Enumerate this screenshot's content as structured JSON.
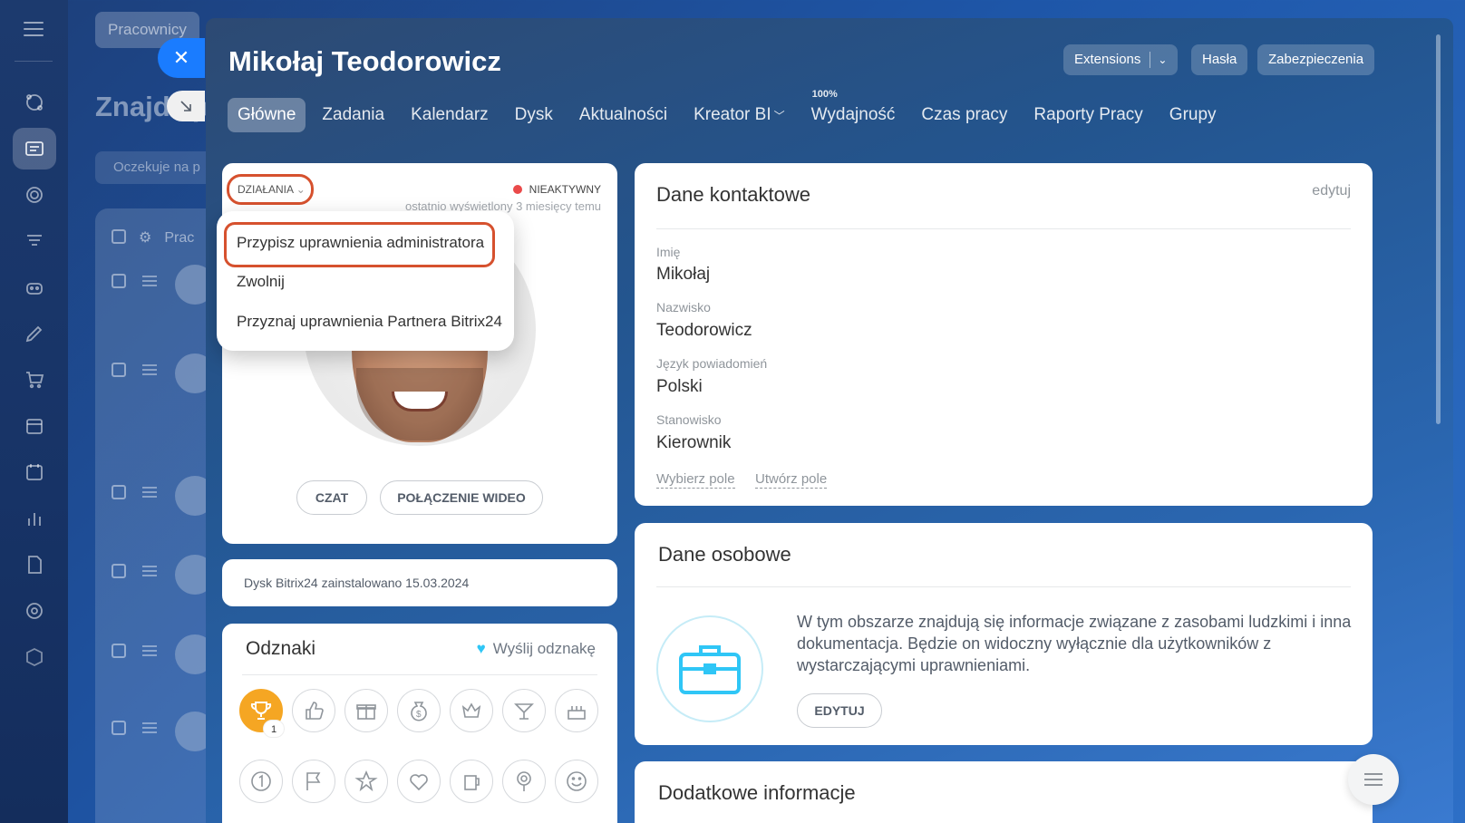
{
  "background": {
    "tab_label": "Pracownicy",
    "page_title": "Znajdź p",
    "filter_placeholder": "Oczekuje na p",
    "table_header": "Prac"
  },
  "slider": {
    "user_name": "Mikołaj Teodorowicz",
    "header_buttons": {
      "extensions": "Extensions",
      "passwords": "Hasła",
      "security": "Zabezpieczenia"
    },
    "tabs": [
      {
        "label": "Główne",
        "active": true
      },
      {
        "label": "Zadania"
      },
      {
        "label": "Kalendarz"
      },
      {
        "label": "Dysk"
      },
      {
        "label": "Aktualności"
      },
      {
        "label": "Kreator BI"
      },
      {
        "label": "Wydajność",
        "super": "100%"
      },
      {
        "label": "Czas pracy"
      },
      {
        "label": "Raporty Pracy"
      },
      {
        "label": "Grupy"
      }
    ]
  },
  "profile": {
    "actions_label": "DZIAŁANIA",
    "status": "NIEAKTYWNY",
    "status_color": "#ea4a4a",
    "last_seen": "ostatnio wyświetlony 3 miesięcy temu",
    "chat_button": "CZAT",
    "video_button": "POŁĄCZENIE WIDEO"
  },
  "dropdown": {
    "items": [
      "Przypisz uprawnienia administratora",
      "Zwolnij",
      "Przyznaj uprawnienia Partnera Bitrix24"
    ],
    "highlight_color": "#d6512e"
  },
  "disk": {
    "text": "Dysk Bitrix24 zainstalowano 15.03.2024"
  },
  "badges": {
    "title": "Odznaki",
    "send_label": "Wyślij odznakę",
    "first_badge_count": "1",
    "icons_row1": [
      "trophy-icon",
      "thumbs-up-icon",
      "gift-icon",
      "money-bag-icon",
      "crown-icon",
      "cocktail-icon",
      "cake-icon"
    ],
    "icons_row2": [
      "number-one-icon",
      "flag-icon",
      "star-icon",
      "heart-icon",
      "beer-icon",
      "flower-icon",
      "smile-icon"
    ]
  },
  "contact": {
    "title": "Dane kontaktowe",
    "edit_label": "edytuj",
    "fields": [
      {
        "label": "Imię",
        "value": "Mikołaj"
      },
      {
        "label": "Nazwisko",
        "value": "Teodorowicz"
      },
      {
        "label": "Język powiadomień",
        "value": "Polski"
      },
      {
        "label": "Stanowisko",
        "value": "Kierownik"
      }
    ],
    "choose_field": "Wybierz pole",
    "create_field": "Utwórz pole"
  },
  "personal": {
    "title": "Dane osobowe",
    "text": "W tym obszarze znajdują się informacje związane z zasobami ludzkimi i inna dokumentacja. Będzie on widoczny wyłącznie dla użytkowników z wystarczającymi uprawnieniami.",
    "edit_button": "EDYTUJ"
  },
  "extra": {
    "title": "Dodatkowe informacje"
  },
  "colors": {
    "accent": "#1a7cff",
    "badge_gold": "#f5a623",
    "briefcase": "#2fc6f6"
  }
}
